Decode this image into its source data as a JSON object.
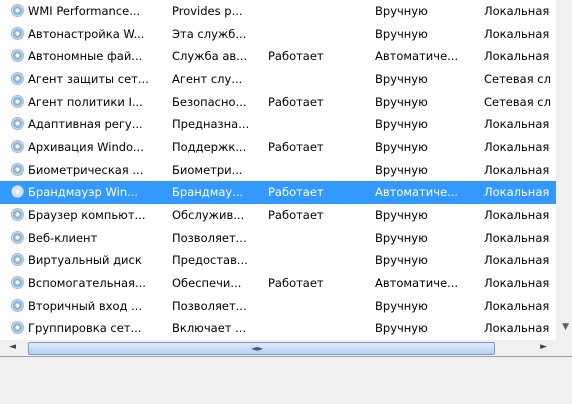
{
  "services": [
    {
      "name": "WMI Performance...",
      "desc": "Provides p...",
      "state": "",
      "startup": "Вручную",
      "logon": "Локальная"
    },
    {
      "name": "Автонастройка W...",
      "desc": "Эта служб...",
      "state": "",
      "startup": "Вручную",
      "logon": "Локальная"
    },
    {
      "name": "Автономные фай...",
      "desc": "Служба ав...",
      "state": "Работает",
      "startup": "Автоматиче...",
      "logon": "Локальная"
    },
    {
      "name": "Агент защиты сет...",
      "desc": "Агент слу...",
      "state": "",
      "startup": "Вручную",
      "logon": "Сетевая сл"
    },
    {
      "name": "Агент политики I...",
      "desc": "Безопасно...",
      "state": "Работает",
      "startup": "Вручную",
      "logon": "Сетевая сл"
    },
    {
      "name": "Адаптивная регу...",
      "desc": "Предназна...",
      "state": "",
      "startup": "Вручную",
      "logon": "Локальная"
    },
    {
      "name": "Архивация Windo...",
      "desc": "Поддержк...",
      "state": "Работает",
      "startup": "Вручную",
      "logon": "Локальная"
    },
    {
      "name": "Биометрическая ...",
      "desc": "Биометри...",
      "state": "",
      "startup": "Вручную",
      "logon": "Локальная"
    },
    {
      "name": "Брандмауэр Win...",
      "desc": "Брандмау...",
      "state": "Работает",
      "startup": "Автоматиче...",
      "logon": "Локальная",
      "selected": true
    },
    {
      "name": "Браузер компьют...",
      "desc": "Обслужив...",
      "state": "Работает",
      "startup": "Вручную",
      "logon": "Локальная"
    },
    {
      "name": "Веб-клиент",
      "desc": "Позволяет...",
      "state": "",
      "startup": "Вручную",
      "logon": "Локальная"
    },
    {
      "name": "Виртуальный диск",
      "desc": "Предостав...",
      "state": "",
      "startup": "Вручную",
      "logon": "Локальная"
    },
    {
      "name": "Вспомогательная...",
      "desc": "Обеспечи...",
      "state": "Работает",
      "startup": "Автоматиче...",
      "logon": "Локальная"
    },
    {
      "name": "Вторичный вход ...",
      "desc": "Позволяет...",
      "state": "",
      "startup": "Вручную",
      "logon": "Локальная"
    },
    {
      "name": "Группировка сет...",
      "desc": "Включает ...",
      "state": "",
      "startup": "Вручную",
      "logon": "Локальная"
    }
  ],
  "icons": {
    "service": "gear-icon",
    "scroll_left": "◄",
    "scroll_right": "►",
    "scroll_down": "▼",
    "grip": "◄►"
  },
  "colors": {
    "selection": "#3399ff",
    "selection_text": "#ffffff"
  }
}
